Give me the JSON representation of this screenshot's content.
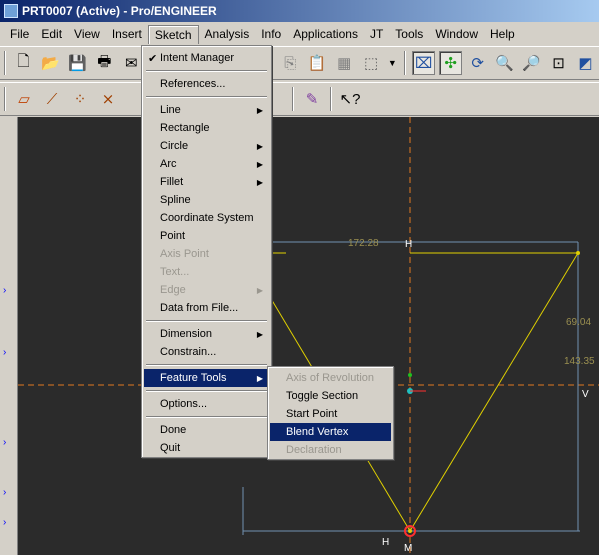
{
  "window": {
    "title": "PRT0007 (Active) - Pro/ENGINEER"
  },
  "menubar": [
    "File",
    "Edit",
    "View",
    "Insert",
    "Sketch",
    "Analysis",
    "Info",
    "Applications",
    "JT",
    "Tools",
    "Window",
    "Help"
  ],
  "sketch_menu": {
    "intent_manager": "Intent Manager",
    "references": "References...",
    "line": "Line",
    "rectangle": "Rectangle",
    "circle": "Circle",
    "arc": "Arc",
    "fillet": "Fillet",
    "spline": "Spline",
    "coordinate_system": "Coordinate System",
    "point": "Point",
    "axis_point": "Axis Point",
    "text": "Text...",
    "edge": "Edge",
    "data_from_file": "Data from File...",
    "dimension": "Dimension",
    "constrain": "Constrain...",
    "feature_tools": "Feature Tools",
    "options": "Options...",
    "done": "Done",
    "quit": "Quit"
  },
  "feature_tools_menu": {
    "axis_of_revolution": "Axis of Revolution",
    "toggle_section": "Toggle Section",
    "start_point": "Start Point",
    "blend_vertex": "Blend Vertex",
    "declaration": "Declaration"
  },
  "sketch_labels": {
    "dim_top": "172.28",
    "dim_right_upper": "69.04",
    "dim_right_lower": "143.35",
    "h_top": "H",
    "h_bottom": "H",
    "v_right": "V",
    "m_bottom": "M"
  },
  "colors": {
    "title_bar": "#0a246a",
    "highlight": "#0a246a",
    "sketch_line": "#e0d000",
    "graphics_bg": "#2b2b2b"
  }
}
